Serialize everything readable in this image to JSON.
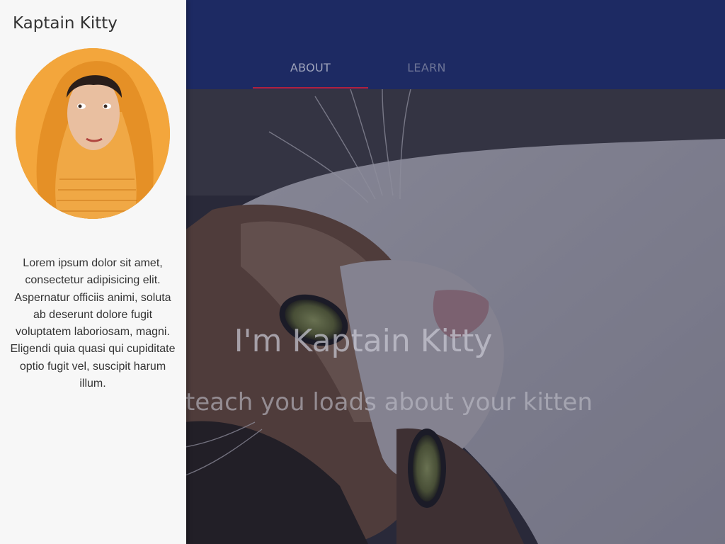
{
  "tabs": [
    {
      "label": "ABOUT",
      "active": true
    },
    {
      "label": "LEARN",
      "active": false
    }
  ],
  "hero": {
    "title": "I'm Kaptain Kitty",
    "subtitle": "teach you loads about your kitten"
  },
  "drawer": {
    "title": "Kaptain Kitty",
    "avatar_icon": "avatar-photo",
    "bio": "Lorem ipsum dolor sit amet, consectetur adipisicing elit. Aspernatur officiis animi, soluta ab deserunt dolore fugit voluptatem laboriosam, magni. Eligendi quia quasi qui cupiditate optio fugit vel, suscipit harum illum."
  },
  "colors": {
    "appbar": "#1d2a63",
    "tab_indicator": "#b2213d",
    "drawer_bg": "#f7f7f7"
  }
}
